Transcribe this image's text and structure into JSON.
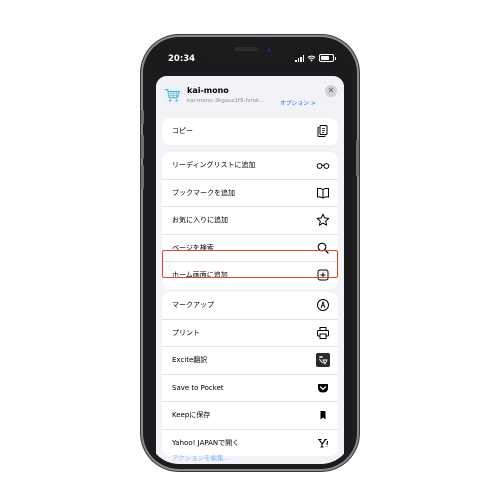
{
  "status_bar": {
    "time": "20:34"
  },
  "share_header": {
    "site_name": "kai-mono",
    "site_url": "kai-mono-3kgauz1f5-hirok...",
    "options_label": "オプション >",
    "close_symbol": "✕"
  },
  "group1": [
    {
      "label": "コピー",
      "icon": "copy-icon"
    }
  ],
  "group2": [
    {
      "label": "リーディングリストに追加",
      "icon": "glasses-icon"
    },
    {
      "label": "ブックマークを追加",
      "icon": "book-icon"
    },
    {
      "label": "お気に入りに追加",
      "icon": "star-icon"
    },
    {
      "label": "ページを検索",
      "icon": "magnifier-icon"
    },
    {
      "label": "ホーム画面に追加",
      "icon": "add-square-icon"
    }
  ],
  "group3": [
    {
      "label": "マークアップ",
      "icon": "markup-icon"
    },
    {
      "label": "プリント",
      "icon": "printer-icon"
    },
    {
      "label": "Excite翻訳",
      "icon": "excite-icon"
    },
    {
      "label": "Save to Pocket",
      "icon": "pocket-icon"
    },
    {
      "label": "Keepに保存",
      "icon": "keep-icon"
    },
    {
      "label": "Yahoo! JAPANで開く",
      "icon": "yahoo-icon"
    }
  ],
  "bottom_link": "アクションを編集...",
  "colors": {
    "highlight": "#e0452b",
    "accent": "#007aff"
  }
}
